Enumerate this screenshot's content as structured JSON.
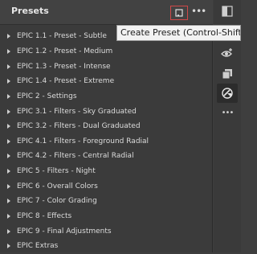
{
  "panel": {
    "title": "Presets",
    "create_preset_tooltip": "Create Preset (Control-Shift-P)",
    "more_label": "•••"
  },
  "presets": [
    {
      "label": "EPIC 1.1 - Preset - Subtle"
    },
    {
      "label": "EPIC 1.2 - Preset - Medium"
    },
    {
      "label": "EPIC 1.3 - Preset - Intense"
    },
    {
      "label": "EPIC 1.4 - Preset - Extreme"
    },
    {
      "label": "EPIC 2 - Settings"
    },
    {
      "label": "EPIC 3.1 - Filters - Sky Graduated"
    },
    {
      "label": "EPIC 3.2 - Filters - Dual Graduated"
    },
    {
      "label": "EPIC 4.1 - Filters - Foreground Radial"
    },
    {
      "label": "EPIC 4.2 - Filters - Central Radial"
    },
    {
      "label": "EPIC 5 - Filters - Night"
    },
    {
      "label": "EPIC 6 - Overall Colors"
    },
    {
      "label": "EPIC 7 - Color Grading"
    },
    {
      "label": "EPIC 8 - Effects"
    },
    {
      "label": "EPIC 9 - Final Adjustments"
    },
    {
      "label": "EPIC Extras"
    }
  ],
  "side_toolbar": {
    "more_label": "•••"
  },
  "colors": {
    "tooltip_border_highlight": "#d04848",
    "panel_bg": "#3b3b3b"
  }
}
